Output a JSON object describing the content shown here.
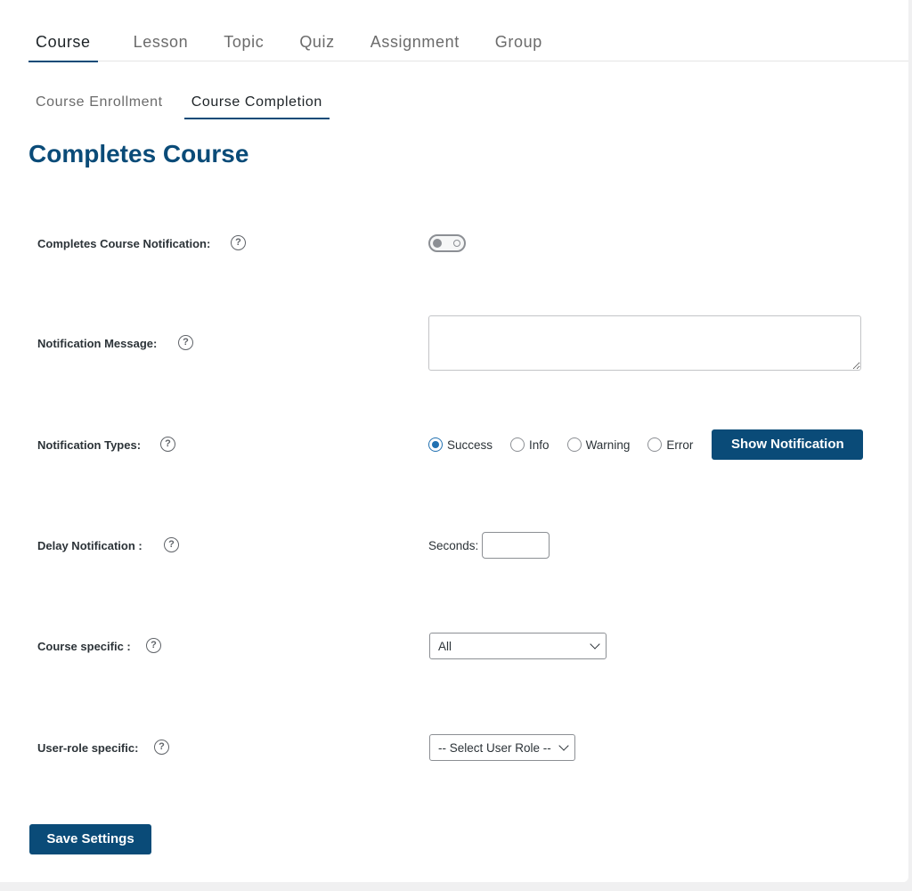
{
  "main_tabs": [
    {
      "label": "Course",
      "active": true
    },
    {
      "label": "Lesson",
      "active": false
    },
    {
      "label": "Topic",
      "active": false
    },
    {
      "label": "Quiz",
      "active": false
    },
    {
      "label": "Assignment",
      "active": false
    },
    {
      "label": "Group",
      "active": false
    }
  ],
  "sub_tabs": [
    {
      "label": "Course Enrollment",
      "active": false
    },
    {
      "label": "Course Completion",
      "active": true
    }
  ],
  "page_title": "Completes Course",
  "help_glyph": "?",
  "fields": {
    "notification": {
      "label": "Completes Course Notification:",
      "enabled": false
    },
    "message": {
      "label": "Notification Message:",
      "value": ""
    },
    "types": {
      "label": "Notification Types:",
      "options": [
        "Success",
        "Info",
        "Warning",
        "Error"
      ],
      "selected": "Success",
      "show_button": "Show Notification"
    },
    "delay": {
      "label": "Delay Notification :",
      "seconds_label": "Seconds:",
      "value": ""
    },
    "course_specific": {
      "label": "Course specific :",
      "selected": "All"
    },
    "user_role": {
      "label": "User-role specific:",
      "selected": "-- Select User Role --"
    }
  },
  "save_button": "Save Settings",
  "colors": {
    "primary": "#0a4b78",
    "radio_checked": "#2271b1",
    "background": "#f0f0f1"
  }
}
